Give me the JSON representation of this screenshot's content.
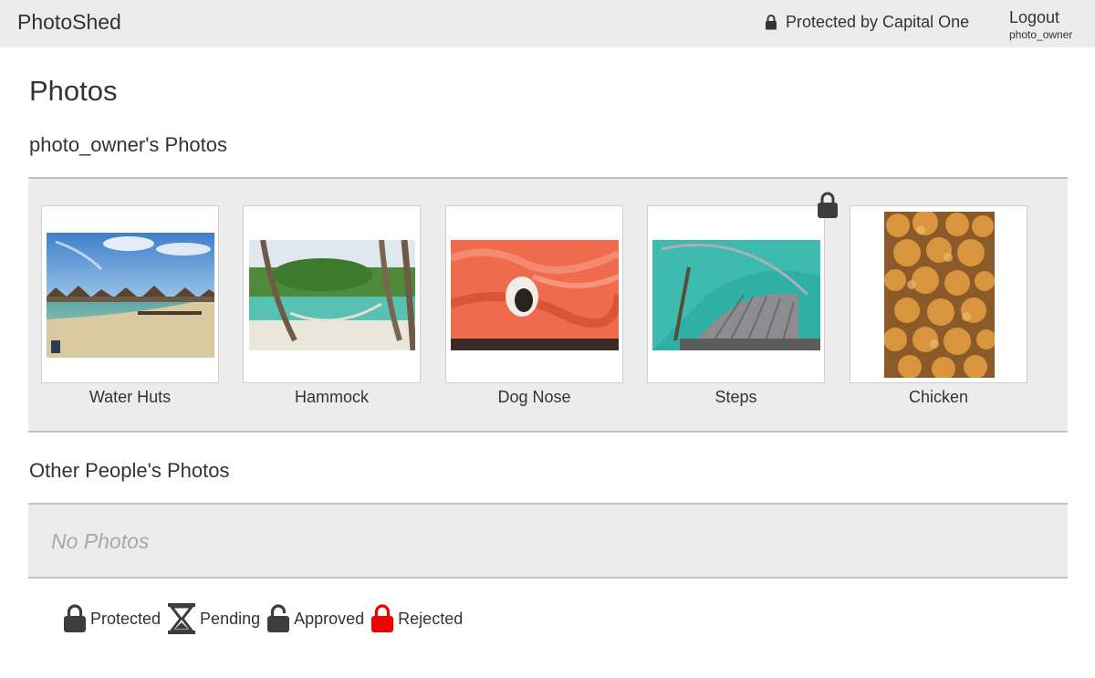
{
  "header": {
    "brand": "PhotoShed",
    "protected_label": "Protected by Capital One",
    "logout_label": "Logout",
    "username": "photo_owner"
  },
  "page": {
    "title": "Photos"
  },
  "own_section": {
    "title": "photo_owner's Photos",
    "photos": [
      {
        "caption": "Water Huts",
        "status": "none"
      },
      {
        "caption": "Hammock",
        "status": "none"
      },
      {
        "caption": "Dog Nose",
        "status": "none"
      },
      {
        "caption": "Steps",
        "status": "protected"
      },
      {
        "caption": "Chicken",
        "status": "none"
      }
    ]
  },
  "others_section": {
    "title": "Other People's Photos",
    "empty_text": "No Photos"
  },
  "legend": {
    "protected": "Protected",
    "pending": "Pending",
    "approved": "Approved",
    "rejected": "Rejected"
  },
  "colors": {
    "topbar_bg": "#ececec",
    "panel_bg": "#ececec",
    "icon_dark": "#333333",
    "rejected_red": "#f20000"
  }
}
